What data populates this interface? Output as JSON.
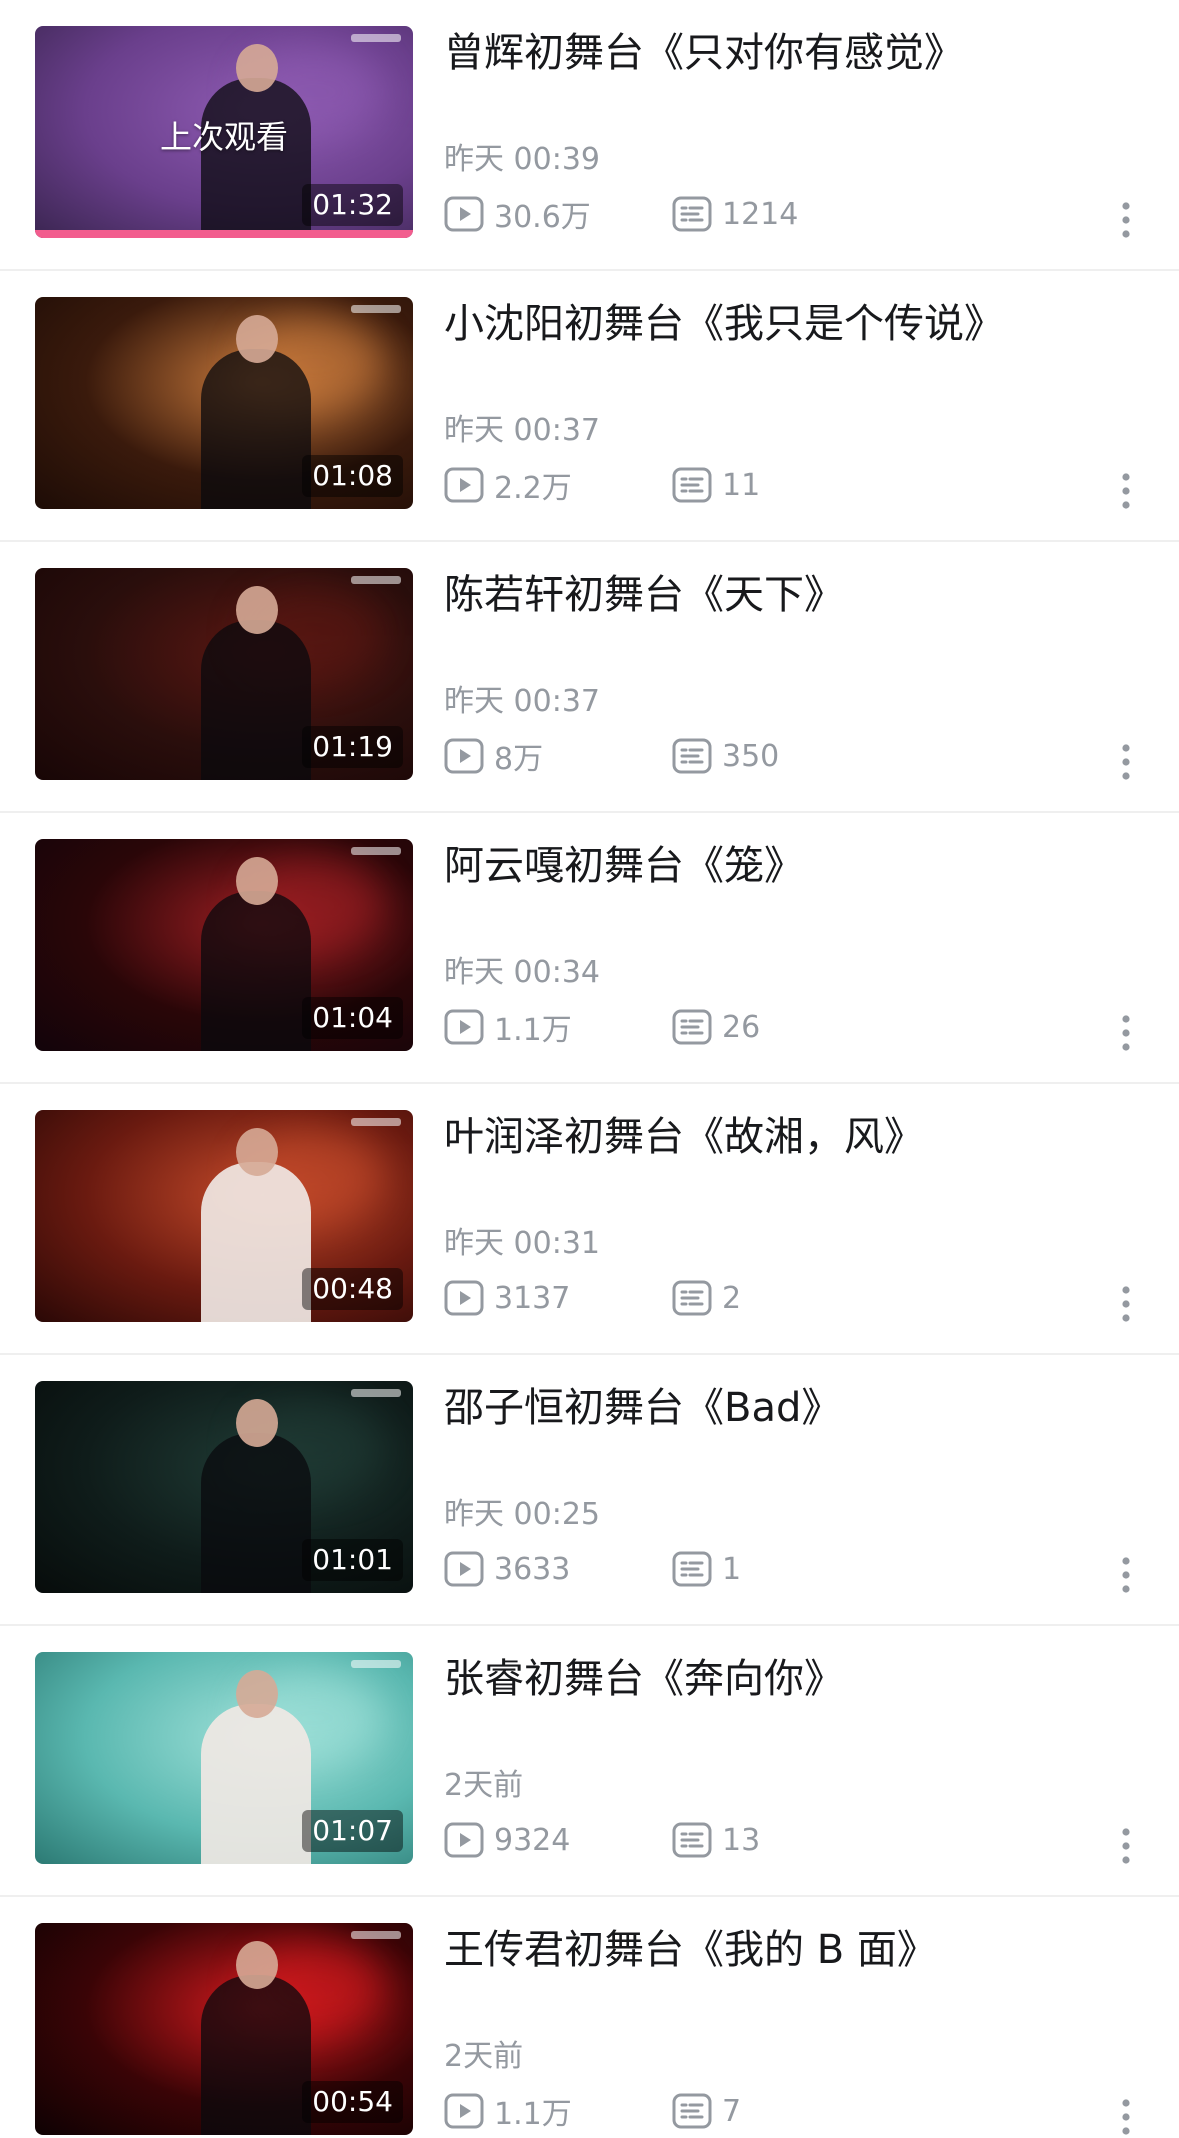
{
  "colors": {
    "text_primary": "#18191c",
    "text_secondary": "#9499a0",
    "progress": "#f25d8e",
    "divider": "#efefef"
  },
  "icons": {
    "plays": "play-count-icon",
    "comments": "danmaku-comment-icon",
    "more": "more-vertical-icon"
  },
  "items": [
    {
      "title": "曾辉初舞台《只对你有感觉》",
      "time": "昨天 00:39",
      "plays": "30.6万",
      "comments": "1214",
      "duration": "01:32",
      "overlay": "上次观看",
      "progress": 1.0,
      "thumb_colors": [
        "#6a3f8c",
        "#8e5bb2",
        "#3a2550"
      ]
    },
    {
      "title": "小沈阳初舞台《我只是个传说》",
      "time": "昨天 00:37",
      "plays": "2.2万",
      "comments": "11",
      "duration": "01:08",
      "thumb_colors": [
        "#3a1a0c",
        "#c97a3c",
        "#1d0c06"
      ]
    },
    {
      "title": "陈若轩初舞台《天下》",
      "time": "昨天 00:37",
      "plays": "8万",
      "comments": "350",
      "duration": "01:19",
      "thumb_colors": [
        "#2a0e0c",
        "#5a1712",
        "#180606"
      ]
    },
    {
      "title": "阿云嘎初舞台《笼》",
      "time": "昨天 00:34",
      "plays": "1.1万",
      "comments": "26",
      "duration": "01:04",
      "thumb_colors": [
        "#2a0608",
        "#9c1e22",
        "#12040a"
      ]
    },
    {
      "title": "叶润泽初舞台《故湘，风》",
      "time": "昨天 00:31",
      "plays": "3137",
      "comments": "2",
      "duration": "00:48",
      "thumb_colors": [
        "#6a1a10",
        "#c44a2a",
        "#2a0806"
      ],
      "light_figure": true
    },
    {
      "title": "邵子恒初舞台《Bad》",
      "time": "昨天 00:25",
      "plays": "3633",
      "comments": "1",
      "duration": "01:01",
      "thumb_colors": [
        "#0f1c1a",
        "#1f3a34",
        "#070c0b"
      ]
    },
    {
      "title": "张睿初舞台《奔向你》",
      "time": "2天前",
      "plays": "9324",
      "comments": "13",
      "duration": "01:07",
      "thumb_colors": [
        "#5ab8b0",
        "#9ee0d8",
        "#2c7a74"
      ],
      "light_figure": true
    },
    {
      "title": "王传君初舞台《我的 B 面》",
      "time": "2天前",
      "plays": "1.1万",
      "comments": "7",
      "duration": "00:54",
      "thumb_colors": [
        "#3a0406",
        "#d41a1e",
        "#0e0203"
      ]
    }
  ]
}
